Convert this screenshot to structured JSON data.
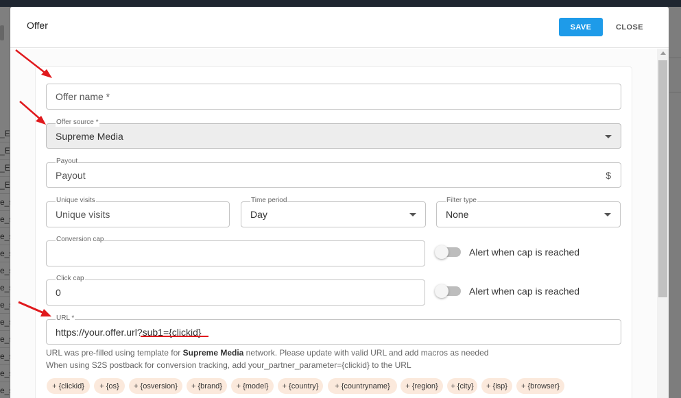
{
  "background": {
    "left_rows": [
      "_EN",
      "_EN",
      "_EN",
      "_EN",
      "e_s",
      "e_s",
      "e_s",
      "e_s",
      "e_s",
      "e_s",
      "e_s",
      "e_s",
      "e_s",
      "e_s",
      "e_s",
      "e_s"
    ]
  },
  "dialog": {
    "title": "Offer",
    "save_label": "SAVE",
    "close_label": "CLOSE"
  },
  "form": {
    "offer_name": {
      "placeholder": "Offer name *",
      "value": ""
    },
    "offer_source": {
      "label": "Offer source *",
      "value": "Supreme Media"
    },
    "payout": {
      "label": "Payout",
      "placeholder": "Payout",
      "currency": "$"
    },
    "unique_visits": {
      "label": "Unique visits",
      "placeholder": "Unique visits"
    },
    "time_period": {
      "label": "Time period",
      "value": "Day"
    },
    "filter_type": {
      "label": "Filter type",
      "value": "None"
    },
    "conversion_cap": {
      "label": "Conversion cap",
      "value": ""
    },
    "conversion_alert": {
      "label": "Alert when cap is reached",
      "checked": false
    },
    "click_cap": {
      "label": "Click cap",
      "value": "0"
    },
    "click_alert": {
      "label": "Alert when cap is reached",
      "checked": false
    },
    "url": {
      "label": "URL *",
      "value_base": "https://your.offer.url",
      "value_query": "?sub1={clickid}"
    },
    "help_line1_pre": "URL was pre-filled using template for ",
    "help_line1_bold": "Supreme Media",
    "help_line1_post": " network. Please update with valid URL and add macros as needed",
    "help_line2": "When using S2S postback for conversion tracking, add your_partner_parameter={clickid} to the URL",
    "macros": [
      "+ {clickid}",
      "+ {os}",
      "+ {osversion}",
      "+ {brand}",
      "+ {model}",
      "+ {country}",
      "+ {countryname}",
      "+ {region}",
      "+ {city}",
      "+ {isp}",
      "+ {browser}"
    ]
  },
  "colors": {
    "accent": "#1e9be9",
    "chip_bg": "#fbe9dc",
    "annotation_red": "#e0191d"
  },
  "icons": {
    "dropdown": "chevron-down-icon",
    "currency": "dollar-icon",
    "annotation": "red-arrow-icon"
  }
}
